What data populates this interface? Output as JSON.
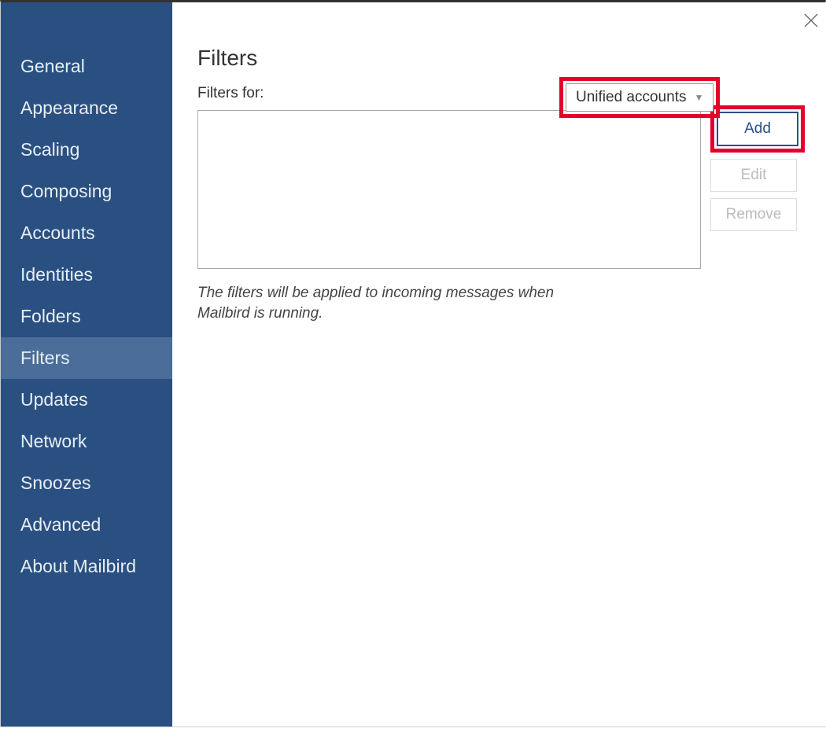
{
  "sidebar": {
    "items": [
      {
        "label": "General"
      },
      {
        "label": "Appearance"
      },
      {
        "label": "Scaling"
      },
      {
        "label": "Composing"
      },
      {
        "label": "Accounts"
      },
      {
        "label": "Identities"
      },
      {
        "label": "Folders"
      },
      {
        "label": "Filters"
      },
      {
        "label": "Updates"
      },
      {
        "label": "Network"
      },
      {
        "label": "Snoozes"
      },
      {
        "label": "Advanced"
      },
      {
        "label": "About Mailbird"
      }
    ],
    "active_index": 7
  },
  "main": {
    "title": "Filters",
    "filters_for_label": "Filters for:",
    "account_dropdown": {
      "selected": "Unified accounts"
    },
    "buttons": {
      "add": "Add",
      "edit": "Edit",
      "remove": "Remove"
    },
    "help_text": "The filters will be applied to incoming messages when Mailbird is running."
  }
}
